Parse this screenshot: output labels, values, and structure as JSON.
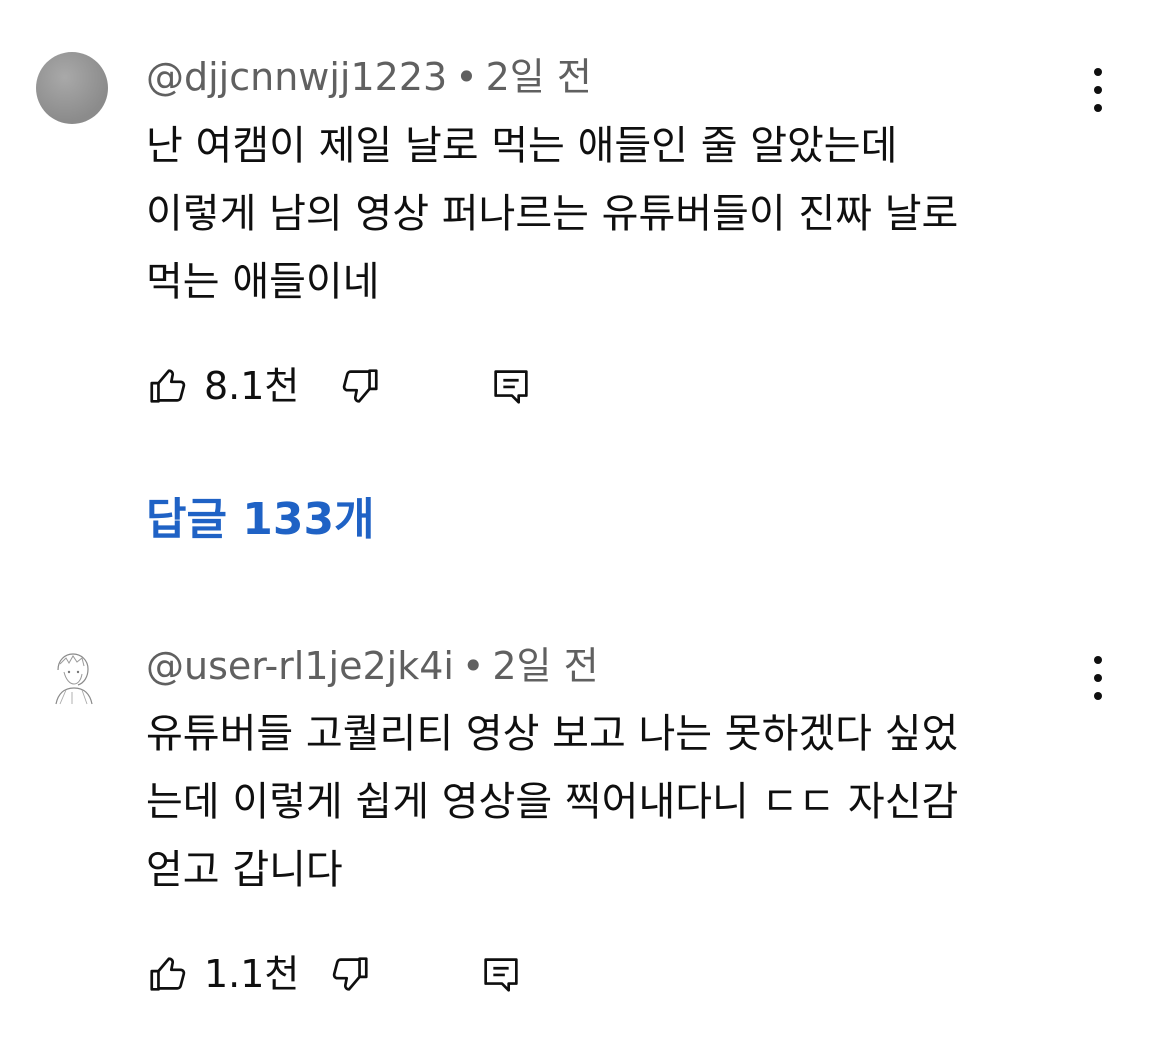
{
  "comments": [
    {
      "author": "@djjcnnwjj1223",
      "separator": "•",
      "time": "2일 전",
      "lines": [
        "난 여캠이 제일 날로 먹는 애들인 줄 알았는데",
        "이렇게 남의 영상 퍼나르는 유튜버들이 진짜 날로",
        "먹는 애들이네"
      ],
      "likes": "8.1천",
      "avatar_icon": "gray-circle-avatar"
    },
    {
      "author": "@user-rl1je2jk4i",
      "separator": "•",
      "time": "2일 전",
      "lines": [
        "유튜버들 고퀄리티 영상 보고 나는 못하겠다 싶었",
        "는데 이렇게 쉽게 영상을 찍어내다니 ㄷㄷ 자신감",
        "얻고 갑니다"
      ],
      "likes": "1.1천",
      "avatar_icon": "sketch-character-avatar"
    }
  ],
  "replies_label": "답글 133개",
  "colors": {
    "meta": "#606060",
    "text": "#0f0f0f",
    "replies": "#1f62c5"
  },
  "icons": [
    "thumbs-up-icon",
    "thumbs-down-icon",
    "reply-comment-icon",
    "more-vert-icon"
  ]
}
